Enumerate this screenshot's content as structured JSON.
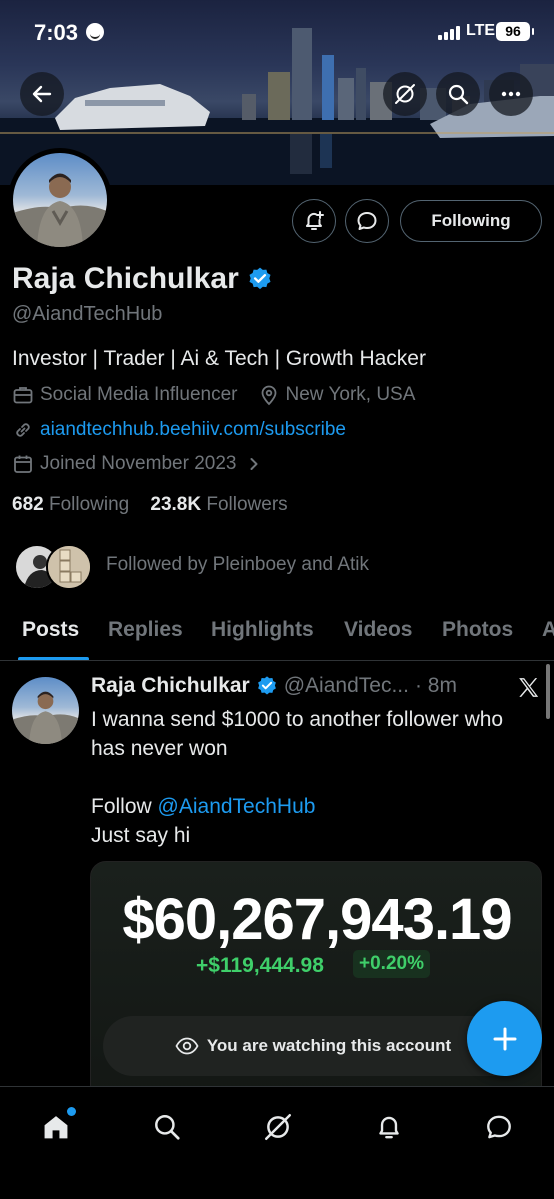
{
  "status_bar": {
    "time": "7:03",
    "network": "LTE",
    "battery": "96"
  },
  "profile": {
    "name": "Raja Chichulkar",
    "handle": "@AiandTechHub",
    "bio": "Investor | Trader | Ai & Tech | Growth Hacker",
    "category": "Social Media Influencer",
    "location": "New York, USA",
    "website": "aiandtechhub.beehiiv.com/subscribe",
    "joined": "Joined November 2023",
    "following_count": "682",
    "following_label": "Following",
    "followers_count": "23.8K",
    "followers_label": "Followers",
    "follow_button": "Following",
    "followed_by": "Followed by Pleinboey and Atik",
    "mini_avatar_text": "R I S K"
  },
  "tabs": [
    "Posts",
    "Replies",
    "Highlights",
    "Videos",
    "Photos",
    "A"
  ],
  "post": {
    "author": "Raja Chichulkar",
    "handle": "@AiandTec...",
    "time": "· 8m",
    "line1": "I wanna send $1000 to another follower who has never won",
    "follow_prefix": "Follow ",
    "mention": "@AiandTechHub",
    "line3": "Just say hi",
    "media": {
      "balance": "$60,267,943.19",
      "gain": "+$119,444.98",
      "percent": "+0.20%",
      "watching": "You are watching this account"
    }
  },
  "colors": {
    "accent": "#1d9bf0",
    "gain": "#3fcf6a",
    "muted": "#71767b"
  }
}
